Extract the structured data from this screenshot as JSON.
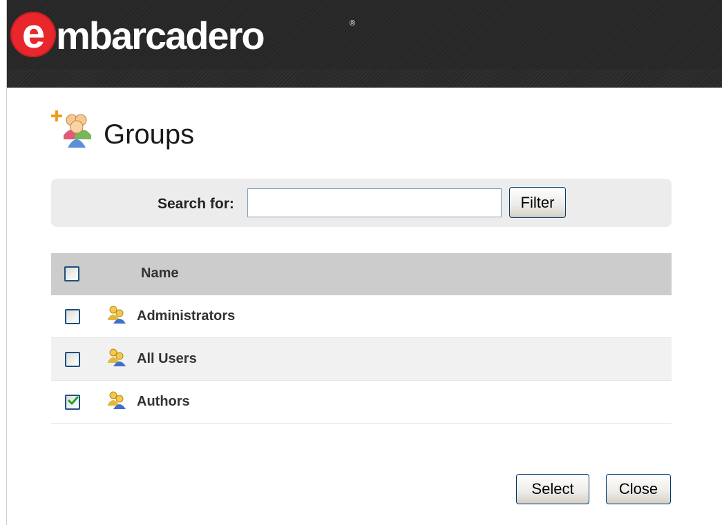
{
  "header": {
    "logo_first_letter": "e",
    "logo_rest": "mbarcadero",
    "logo_mark": "®"
  },
  "page": {
    "title": "Groups",
    "title_icon": "add-group-icon"
  },
  "search": {
    "label": "Search for:",
    "value": "",
    "filter_label": "Filter"
  },
  "table": {
    "columns": [
      "Name"
    ],
    "header_checked": false,
    "rows": [
      {
        "name": "Administrators",
        "checked": false,
        "icon": "user-group-icon"
      },
      {
        "name": "All Users",
        "checked": false,
        "icon": "user-group-icon"
      },
      {
        "name": "Authors",
        "checked": true,
        "icon": "user-group-icon"
      }
    ]
  },
  "actions": {
    "select_label": "Select",
    "close_label": "Close"
  },
  "colors": {
    "brand_red": "#e8262c",
    "header_bg": "#262626",
    "checkbox_border": "#1c5180",
    "check_mark": "#21a121"
  }
}
